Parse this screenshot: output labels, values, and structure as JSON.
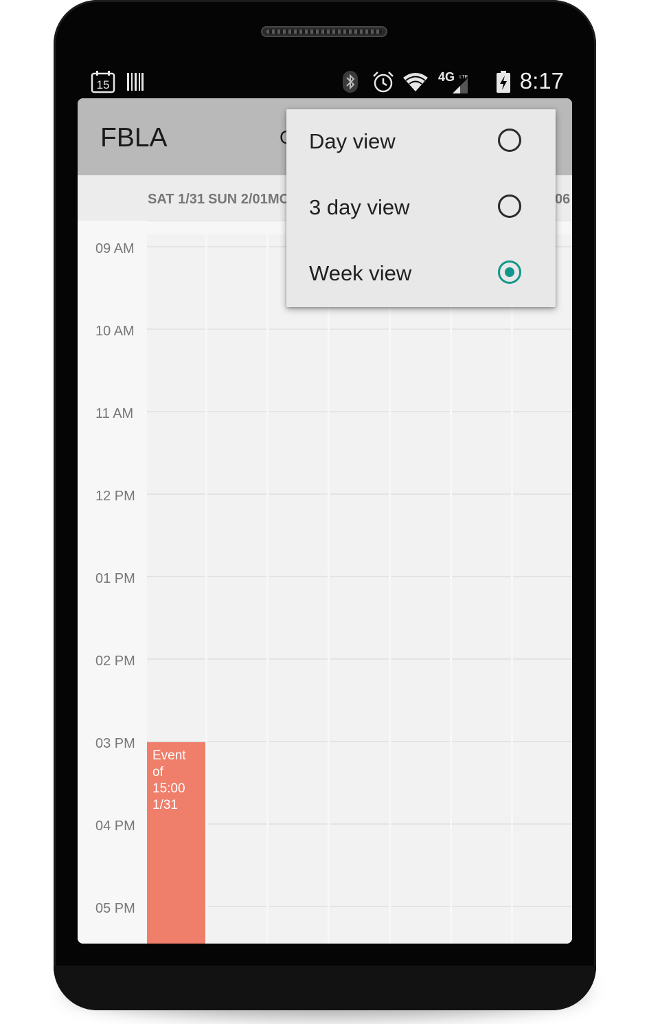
{
  "status_bar": {
    "calendar_notification_day": "15",
    "time": "8:17",
    "network_label": "4G",
    "network_sublabel": "LTE"
  },
  "app": {
    "title": "FBLA",
    "title_hidden_fragment": "G"
  },
  "week_header": {
    "days": [
      "SAT 1/31",
      "SUN 2/01",
      "MO"
    ],
    "trailing": "06"
  },
  "time_labels": [
    "09 AM",
    "10 AM",
    "11 AM",
    "12 PM",
    "01 PM",
    "02 PM",
    "03 PM",
    "04 PM",
    "05 PM"
  ],
  "events": [
    {
      "lines": [
        "Event",
        "of",
        "15:00",
        "1/31"
      ],
      "color": "#ef7e6a"
    }
  ],
  "view_menu": {
    "items": [
      {
        "label": "Day view",
        "selected": false
      },
      {
        "label": "3 day view",
        "selected": false
      },
      {
        "label": "Week view",
        "selected": true
      }
    ]
  },
  "colors": {
    "accent": "#12968a",
    "event": "#ef7e6a",
    "appbar": "#b9b9b9"
  }
}
